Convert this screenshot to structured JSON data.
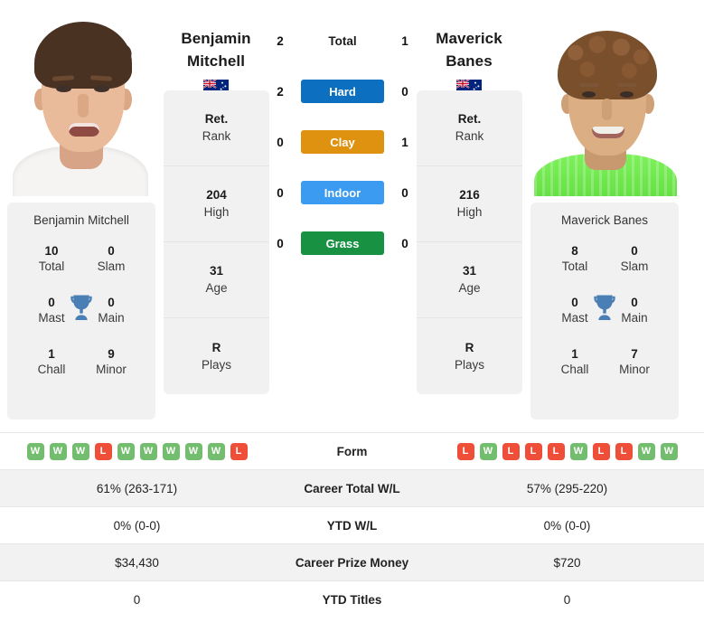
{
  "players": {
    "left": {
      "first_name": "Benjamin",
      "last_name": "Mitchell",
      "full_name": "Benjamin Mitchell",
      "country": "Australia",
      "flag_icon": "australia-flag-icon",
      "info": [
        {
          "value": "Ret.",
          "label": "Rank"
        },
        {
          "value": "204",
          "label": "High"
        },
        {
          "value": "31",
          "label": "Age"
        },
        {
          "value": "R",
          "label": "Plays"
        }
      ],
      "titles": {
        "total": "10",
        "total_label": "Total",
        "slam": "0",
        "slam_label": "Slam",
        "mast": "0",
        "mast_label": "Mast",
        "main": "0",
        "main_label": "Main",
        "chall": "1",
        "chall_label": "Chall",
        "minor": "9",
        "minor_label": "Minor"
      },
      "form": [
        "W",
        "W",
        "W",
        "L",
        "W",
        "W",
        "W",
        "W",
        "W",
        "L"
      ],
      "career_total_wl": "61% (263-171)",
      "ytd_wl": "0% (0-0)",
      "career_prize_money": "$34,430",
      "ytd_titles": "0"
    },
    "right": {
      "first_name": "Maverick",
      "last_name": "Banes",
      "full_name": "Maverick Banes",
      "country": "Australia",
      "flag_icon": "australia-flag-icon",
      "info": [
        {
          "value": "Ret.",
          "label": "Rank"
        },
        {
          "value": "216",
          "label": "High"
        },
        {
          "value": "31",
          "label": "Age"
        },
        {
          "value": "R",
          "label": "Plays"
        }
      ],
      "titles": {
        "total": "8",
        "total_label": "Total",
        "slam": "0",
        "slam_label": "Slam",
        "mast": "0",
        "mast_label": "Mast",
        "main": "0",
        "main_label": "Main",
        "chall": "1",
        "chall_label": "Chall",
        "minor": "7",
        "minor_label": "Minor"
      },
      "form": [
        "L",
        "W",
        "L",
        "L",
        "L",
        "W",
        "L",
        "L",
        "W",
        "W"
      ],
      "career_total_wl": "57% (295-220)",
      "ytd_wl": "0% (0-0)",
      "career_prize_money": "$720",
      "ytd_titles": "0"
    }
  },
  "head_to_head": [
    {
      "label": "Total",
      "left": "2",
      "right": "1",
      "color": ""
    },
    {
      "label": "Hard",
      "left": "2",
      "right": "0",
      "color": "#0c6fc0"
    },
    {
      "label": "Clay",
      "left": "0",
      "right": "1",
      "color": "#de9210"
    },
    {
      "label": "Indoor",
      "left": "0",
      "right": "0",
      "color": "#3b9bf0"
    },
    {
      "label": "Grass",
      "left": "0",
      "right": "0",
      "color": "#189142"
    }
  ],
  "table_rows": [
    {
      "label": "Form",
      "left": "",
      "right": "",
      "type": "form",
      "shaded": false
    },
    {
      "label": "Career Total W/L",
      "left": "61% (263-171)",
      "right": "57% (295-220)",
      "type": "text",
      "shaded": true
    },
    {
      "label": "YTD W/L",
      "left": "0% (0-0)",
      "right": "0% (0-0)",
      "type": "text",
      "shaded": false
    },
    {
      "label": "Career Prize Money",
      "left": "$34,430",
      "right": "$720",
      "type": "text",
      "shaded": true
    },
    {
      "label": "YTD Titles",
      "left": "0",
      "right": "0",
      "type": "text",
      "shaded": false
    }
  ],
  "colors": {
    "hard": "#0c6fc0",
    "clay": "#de9210",
    "indoor": "#3b9bf0",
    "grass": "#189142",
    "win_badge": "#73bd6e",
    "loss_badge": "#ef4f38",
    "card_bg": "#f1f1f1",
    "row_shade": "#f2f2f2",
    "trophy": "#4a7fb5"
  }
}
